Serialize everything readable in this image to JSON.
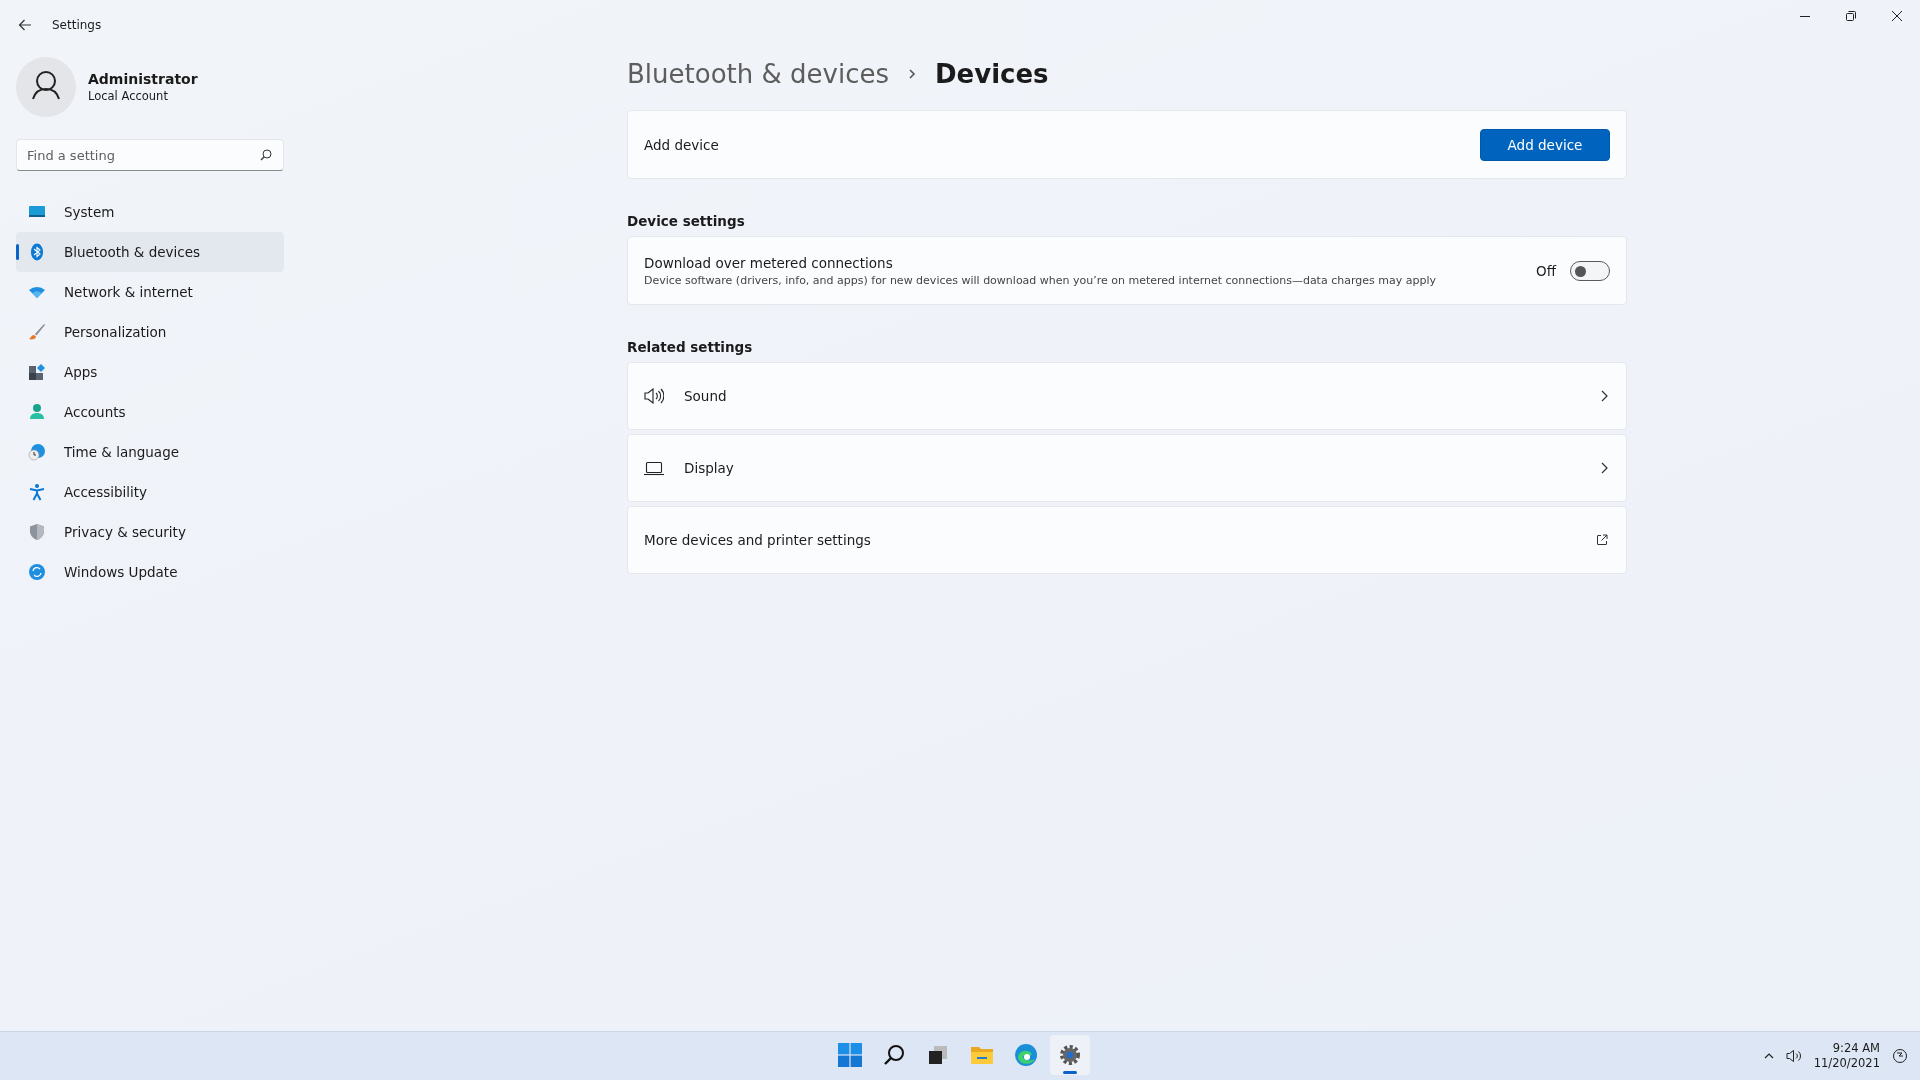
{
  "window": {
    "title": "Settings"
  },
  "account": {
    "name": "Administrator",
    "type": "Local Account"
  },
  "search": {
    "placeholder": "Find a setting"
  },
  "nav": [
    {
      "label": "System",
      "selected": false
    },
    {
      "label": "Bluetooth & devices",
      "selected": true
    },
    {
      "label": "Network & internet",
      "selected": false
    },
    {
      "label": "Personalization",
      "selected": false
    },
    {
      "label": "Apps",
      "selected": false
    },
    {
      "label": "Accounts",
      "selected": false
    },
    {
      "label": "Time & language",
      "selected": false
    },
    {
      "label": "Accessibility",
      "selected": false
    },
    {
      "label": "Privacy & security",
      "selected": false
    },
    {
      "label": "Windows Update",
      "selected": false
    }
  ],
  "breadcrumb": {
    "parent": "Bluetooth & devices",
    "current": "Devices"
  },
  "add_device": {
    "label": "Add device",
    "button": "Add device"
  },
  "device_settings": {
    "heading": "Device settings",
    "title": "Download over metered connections",
    "description": "Device software (drivers, info, and apps) for new devices will download when you’re on metered internet connections—data charges may apply",
    "state_label": "Off",
    "on": false
  },
  "related_settings": {
    "heading": "Related settings",
    "items": [
      {
        "kind": "internal",
        "label": "Sound"
      },
      {
        "kind": "internal",
        "label": "Display"
      },
      {
        "kind": "external",
        "label": "More devices and printer settings"
      }
    ]
  },
  "taskbar": {
    "apps": [
      {
        "selected": false
      },
      {
        "selected": false
      },
      {
        "selected": false
      },
      {
        "selected": false
      },
      {
        "selected": false
      },
      {
        "selected": true
      }
    ],
    "time": "9:24 AM",
    "date": "11/20/2021"
  }
}
